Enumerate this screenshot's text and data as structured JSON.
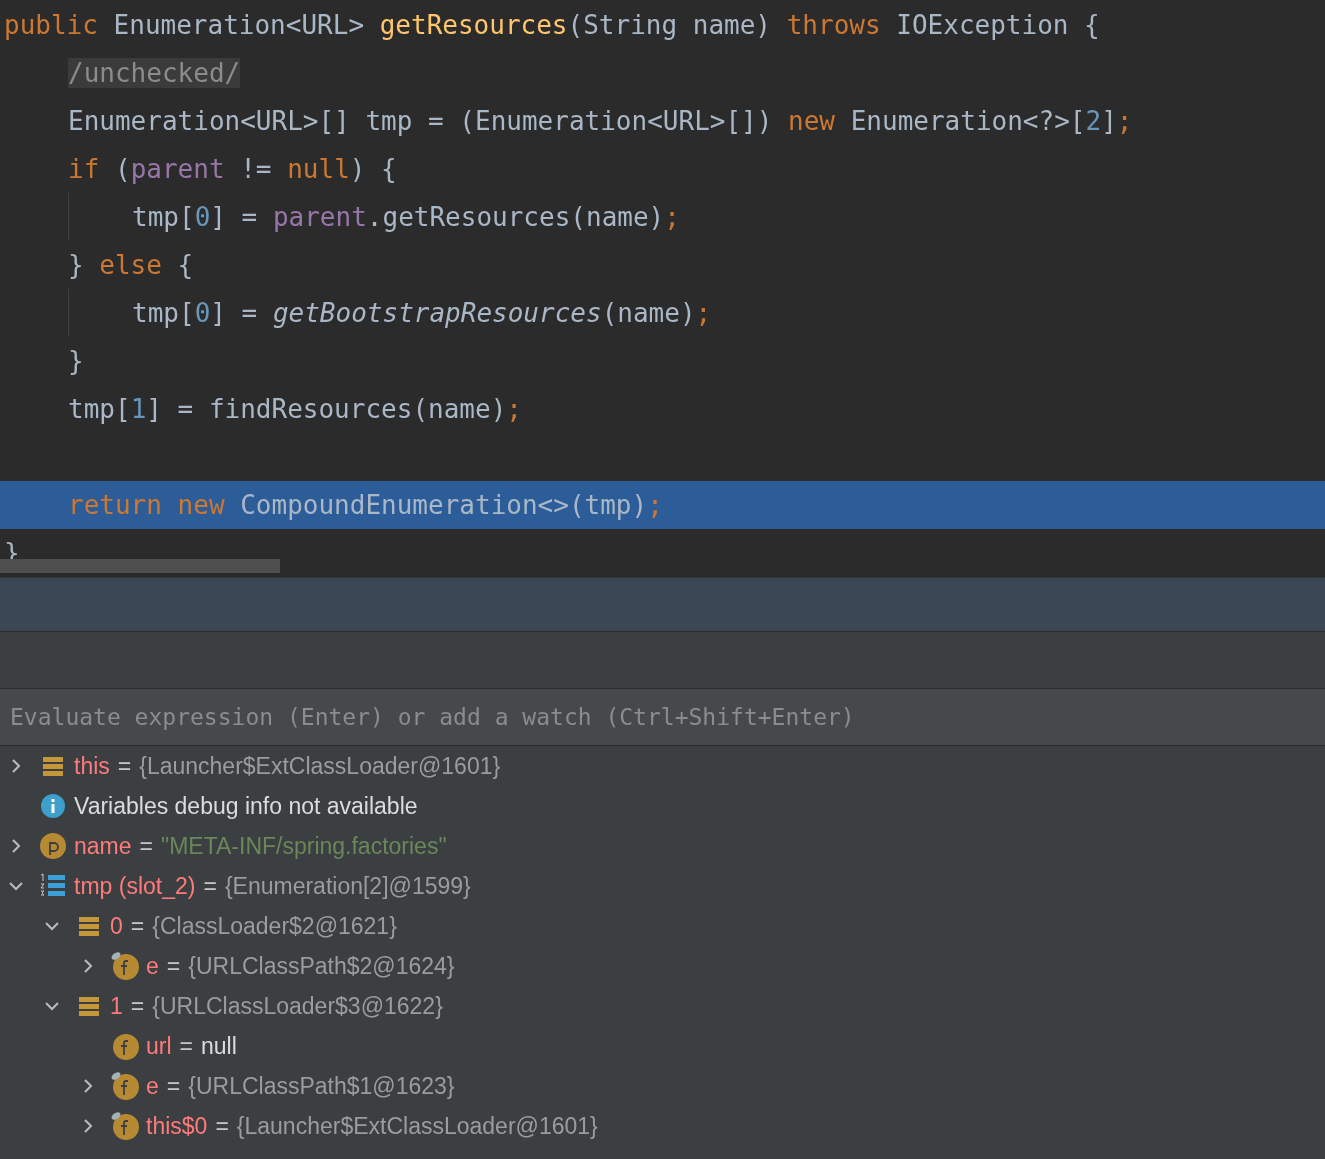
{
  "editor": {
    "lines": [
      {
        "current": false,
        "guide": false,
        "tokens": [
          {
            "kind": "kw",
            "text": "public "
          },
          {
            "kind": "plain",
            "text": "Enumeration<URL> "
          },
          {
            "kind": "method",
            "text": "getResources"
          },
          {
            "kind": "plain",
            "text": "(String name) "
          },
          {
            "kind": "kw",
            "text": "throws "
          },
          {
            "kind": "plain",
            "text": "IOException {"
          }
        ],
        "children": [
          {
            "current": false,
            "guide": false,
            "tokens": [
              {
                "kind": "folded",
                "text": "/unchecked/"
              }
            ]
          },
          {
            "current": false,
            "guide": false,
            "tokens": [
              {
                "kind": "plain",
                "text": "Enumeration<URL>[] tmp = (Enumeration<URL>[]) "
              },
              {
                "kind": "kw",
                "text": "new "
              },
              {
                "kind": "plain",
                "text": "Enumeration<?>["
              },
              {
                "kind": "num",
                "text": "2"
              },
              {
                "kind": "plain",
                "text": "]"
              },
              {
                "kind": "kw",
                "text": ";"
              }
            ]
          },
          {
            "current": false,
            "guide": false,
            "tokens": [
              {
                "kind": "kw",
                "text": "if "
              },
              {
                "kind": "plain",
                "text": "("
              },
              {
                "kind": "field",
                "text": "parent "
              },
              {
                "kind": "plain",
                "text": "!= "
              },
              {
                "kind": "kw",
                "text": "null"
              },
              {
                "kind": "plain",
                "text": ") {"
              }
            ],
            "children": [
              {
                "current": false,
                "guide": true,
                "tokens": [
                  {
                    "kind": "plain",
                    "text": "tmp["
                  },
                  {
                    "kind": "num",
                    "text": "0"
                  },
                  {
                    "kind": "plain",
                    "text": "] = "
                  },
                  {
                    "kind": "field",
                    "text": "parent"
                  },
                  {
                    "kind": "plain",
                    "text": ".getResources(name)"
                  },
                  {
                    "kind": "kw",
                    "text": ";"
                  }
                ]
              }
            ]
          },
          {
            "current": false,
            "guide": false,
            "tokens": [
              {
                "kind": "plain",
                "text": "} "
              },
              {
                "kind": "kw",
                "text": "else "
              },
              {
                "kind": "plain",
                "text": "{"
              }
            ],
            "children": [
              {
                "current": false,
                "guide": true,
                "tokens": [
                  {
                    "kind": "plain",
                    "text": "tmp["
                  },
                  {
                    "kind": "num",
                    "text": "0"
                  },
                  {
                    "kind": "plain",
                    "text": "] = "
                  },
                  {
                    "kind": "static",
                    "text": "getBootstrapResources"
                  },
                  {
                    "kind": "plain",
                    "text": "(name)"
                  },
                  {
                    "kind": "kw",
                    "text": ";"
                  }
                ]
              }
            ]
          },
          {
            "current": false,
            "guide": false,
            "tokens": [
              {
                "kind": "plain",
                "text": "}"
              }
            ]
          },
          {
            "current": false,
            "guide": false,
            "tokens": [
              {
                "kind": "plain",
                "text": "tmp["
              },
              {
                "kind": "num",
                "text": "1"
              },
              {
                "kind": "plain",
                "text": "] = findResources(name)"
              },
              {
                "kind": "kw",
                "text": ";"
              }
            ]
          },
          {
            "current": false,
            "guide": false
          },
          {
            "current": true,
            "guide": false,
            "tokens": [
              {
                "kind": "kw",
                "text": "return new "
              },
              {
                "kind": "plain",
                "text": "CompoundEnumeration<>(tmp)"
              },
              {
                "kind": "kw",
                "text": ";"
              }
            ]
          }
        ]
      },
      {
        "current": false,
        "guide": false,
        "tokens": [
          {
            "kind": "plain",
            "text": "}"
          }
        ]
      }
    ]
  },
  "evaluate": {
    "placeholder": "Evaluate expression (Enter) or add a watch (Ctrl+Shift+Enter)"
  },
  "variables": [
    {
      "kind": "object",
      "name": "this",
      "operator": "=",
      "value": {
        "kind": "ref",
        "text": "{Launcher$ExtClassLoader@1601}"
      },
      "expanded": false
    },
    {
      "kind": "info",
      "text": "Variables debug info not available"
    },
    {
      "kind": "param",
      "name": "name",
      "operator": "=",
      "value": {
        "kind": "string",
        "text": "\"META-INF/spring.factories\""
      },
      "expanded": false
    },
    {
      "kind": "array",
      "name": "tmp (slot_2)",
      "operator": "=",
      "value": {
        "kind": "ref",
        "text": "{Enumeration[2]@1599}"
      },
      "expanded": true,
      "children": [
        {
          "kind": "object",
          "name": "0",
          "operator": "=",
          "value": {
            "kind": "ref",
            "text": "{ClassLoader$2@1621}"
          },
          "expanded": true,
          "children": [
            {
              "kind": "field",
              "name": "e",
              "operator": "=",
              "value": {
                "kind": "ref",
                "text": "{URLClassPath$2@1624}"
              },
              "expanded": false,
              "final": true
            }
          ]
        },
        {
          "kind": "object",
          "name": "1",
          "operator": "=",
          "value": {
            "kind": "ref",
            "text": "{URLClassLoader$3@1622}"
          },
          "expanded": true,
          "children": [
            {
              "kind": "field",
              "name": "url",
              "operator": "=",
              "value": {
                "kind": "null",
                "text": "null"
              },
              "final": false
            },
            {
              "kind": "field",
              "name": "e",
              "operator": "=",
              "value": {
                "kind": "ref",
                "text": "{URLClassPath$1@1623}"
              },
              "expanded": false,
              "final": true
            },
            {
              "kind": "field",
              "name": "this$0",
              "operator": "=",
              "value": {
                "kind": "ref",
                "text": "{Launcher$ExtClassLoader@1601}"
              },
              "expanded": false,
              "final": true
            }
          ]
        }
      ]
    }
  ]
}
